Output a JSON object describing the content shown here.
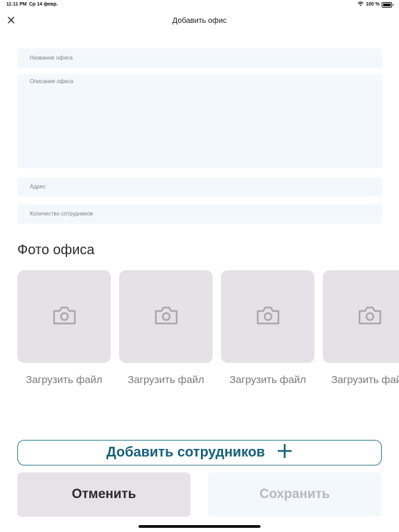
{
  "status_bar": {
    "time": "11:11 PM",
    "date": "Ср 14 февр.",
    "battery": "100 %"
  },
  "header": {
    "title": "Добавить офис",
    "close_icon": "close-icon"
  },
  "form": {
    "name_placeholder": "Название офиса",
    "description_placeholder": "Описание офиса",
    "address_placeholder": "Адрес",
    "employees_placeholder": "Количество сотрудников"
  },
  "photos": {
    "title": "Фото офиса",
    "items": [
      {
        "label": "Загрузить файл",
        "icon": "camera-icon"
      },
      {
        "label": "Загрузить файл",
        "icon": "camera-icon"
      },
      {
        "label": "Загрузить файл",
        "icon": "camera-icon"
      },
      {
        "label": "Загрузить файл",
        "icon": "camera-icon"
      }
    ]
  },
  "actions": {
    "add_employees": "Добавить сотрудников",
    "cancel": "Отменить",
    "save": "Сохранить"
  },
  "colors": {
    "accent": "#15617a",
    "accent_border": "#2f7c95",
    "field_bg": "#f3f8fd",
    "photo_bg": "#e4e2e6",
    "cancel_bg": "#e5e3e6",
    "save_text_disabled": "#b7b9bc"
  }
}
